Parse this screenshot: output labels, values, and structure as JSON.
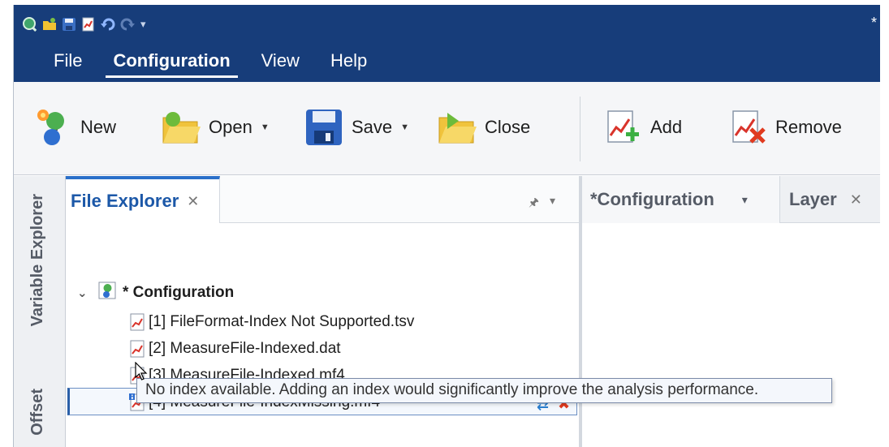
{
  "title_marker": "*",
  "menu": {
    "items": [
      {
        "label": "File",
        "active": false
      },
      {
        "label": "Configuration",
        "active": true
      },
      {
        "label": "View",
        "active": false
      },
      {
        "label": "Help",
        "active": false
      }
    ]
  },
  "ribbon": {
    "new_label": "New",
    "open_label": "Open",
    "save_label": "Save",
    "close_label": "Close",
    "add_label": "Add",
    "remove_label": "Remove"
  },
  "side_tabs": {
    "variable_explorer": "Variable Explorer",
    "offset": "Offset"
  },
  "file_explorer": {
    "title": "File Explorer",
    "root_label": "* Configuration",
    "files": [
      {
        "label": "[1] FileFormat-Index Not Supported.tsv"
      },
      {
        "label": "[2] MeasureFile-Indexed.dat"
      },
      {
        "label": "[3] MeasureFile-Indexed.mf4"
      },
      {
        "label": "[4] MeasureFile-IndexMissing.mf4"
      }
    ]
  },
  "config_pane": {
    "tab1": "*Configuration",
    "tab2": "Layer"
  },
  "tooltip": {
    "text": "No index available. Adding an index would significantly improve the analysis performance."
  },
  "colors": {
    "title_bar": "#173d7a",
    "accent": "#2a6fc9",
    "remove_red": "#e03a1f"
  }
}
